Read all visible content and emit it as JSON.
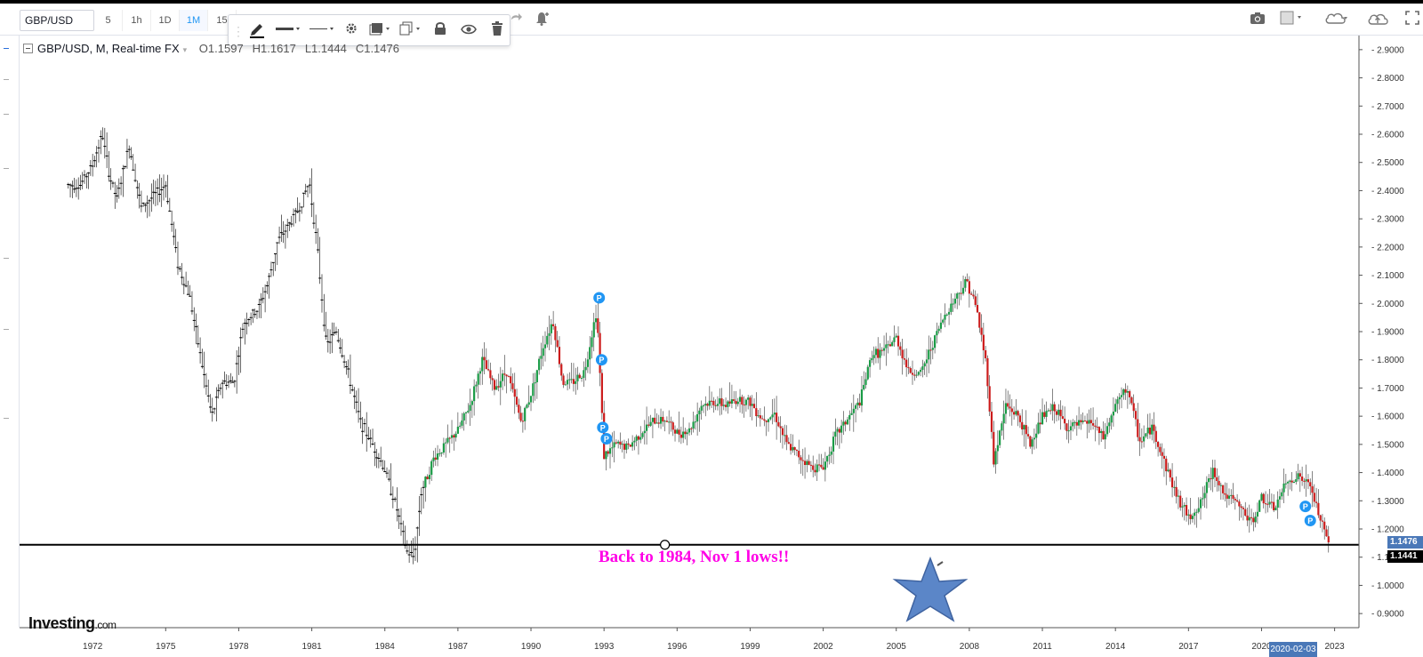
{
  "toolbar": {
    "symbol": "GBP/USD",
    "intervals": [
      "5",
      "1h",
      "1D",
      "1M",
      "15"
    ],
    "active_interval": "1M"
  },
  "legend": {
    "title": "GBP/USD, M, Real-time FX",
    "open": "O1.1597",
    "high": "H1.1617",
    "low": "L1.1444",
    "close": "C1.1476"
  },
  "annotation": {
    "text": "Back to 1984, Nov 1 lows!!",
    "color": "#ff00e6"
  },
  "logo": {
    "brand": "Investing",
    "suffix": ".com"
  },
  "price_axis": {
    "ticks": [
      "2.9000",
      "2.8000",
      "2.7000",
      "2.6000",
      "2.5000",
      "2.4000",
      "2.3000",
      "2.2000",
      "2.1000",
      "2.0000",
      "1.9000",
      "1.8000",
      "1.7000",
      "1.6000",
      "1.5000",
      "1.4000",
      "1.3000",
      "1.2000",
      "1.1000",
      "1.0000",
      "0.9000"
    ],
    "current_price": "1.1476",
    "line_price": "1.1441",
    "current_price_color": "#4a78b8",
    "line_price_color": "#000000"
  },
  "time_axis": {
    "ticks": [
      "1972",
      "1975",
      "1978",
      "1981",
      "1984",
      "1987",
      "1990",
      "1993",
      "1996",
      "1999",
      "2002",
      "2005",
      "2008",
      "2011",
      "2014",
      "2017",
      "2020",
      "2023"
    ],
    "cursor_date": "2020-02-03"
  },
  "colors": {
    "up_candle": "#1a9b46",
    "down_candle": "#cc1c1c",
    "legacy_bar": "#000000",
    "marker": "#2196f3"
  },
  "icons": [
    "camera-icon",
    "square-icon",
    "cloud-icon",
    "cloud-upload-icon",
    "fullscreen-icon",
    "pencil-icon",
    "line-icon",
    "settings-icon",
    "layers-icon",
    "clone-icon",
    "lock-icon",
    "eye-icon",
    "trash-icon",
    "alert-add-icon",
    "redo-icon"
  ],
  "chart_data": {
    "type": "line",
    "title": "GBP/USD, M, Real-time FX",
    "xlabel": "",
    "ylabel": "",
    "ylim": [
      0.85,
      2.95
    ],
    "x_range": [
      1969,
      2024
    ],
    "horizontal_line": 1.1441,
    "series": [
      {
        "values": [
          [
            1971.0,
            2.42
          ],
          [
            1971.5,
            2.42
          ],
          [
            1972.0,
            2.49
          ],
          [
            1972.4,
            2.6
          ],
          [
            1972.7,
            2.45
          ],
          [
            1973.0,
            2.37
          ],
          [
            1973.5,
            2.56
          ],
          [
            1974.0,
            2.34
          ],
          [
            1974.5,
            2.38
          ],
          [
            1975.0,
            2.42
          ],
          [
            1975.5,
            2.14
          ],
          [
            1976.0,
            2.02
          ],
          [
            1976.5,
            1.78
          ],
          [
            1976.9,
            1.6
          ],
          [
            1977.3,
            1.72
          ],
          [
            1977.8,
            1.72
          ],
          [
            1978.2,
            1.93
          ],
          [
            1978.8,
            1.98
          ],
          [
            1979.2,
            2.07
          ],
          [
            1979.6,
            2.22
          ],
          [
            1980.0,
            2.27
          ],
          [
            1980.5,
            2.34
          ],
          [
            1980.9,
            2.43
          ],
          [
            1981.2,
            2.22
          ],
          [
            1981.6,
            1.85
          ],
          [
            1982.0,
            1.9
          ],
          [
            1982.5,
            1.75
          ],
          [
            1983.0,
            1.58
          ],
          [
            1983.5,
            1.5
          ],
          [
            1984.0,
            1.41
          ],
          [
            1984.5,
            1.27
          ],
          [
            1984.9,
            1.12
          ],
          [
            1985.2,
            1.1
          ],
          [
            1985.5,
            1.33
          ],
          [
            1986.0,
            1.45
          ],
          [
            1986.5,
            1.5
          ],
          [
            1987.0,
            1.55
          ],
          [
            1987.5,
            1.64
          ],
          [
            1988.0,
            1.8
          ],
          [
            1988.5,
            1.7
          ],
          [
            1989.0,
            1.76
          ],
          [
            1989.6,
            1.58
          ],
          [
            1990.0,
            1.68
          ],
          [
            1990.5,
            1.85
          ],
          [
            1990.9,
            1.94
          ],
          [
            1991.3,
            1.72
          ],
          [
            1991.7,
            1.72
          ],
          [
            1992.2,
            1.76
          ],
          [
            1992.7,
            1.98
          ],
          [
            1993.0,
            1.46
          ],
          [
            1993.5,
            1.5
          ],
          [
            1994.0,
            1.49
          ],
          [
            1994.5,
            1.54
          ],
          [
            1995.0,
            1.58
          ],
          [
            1995.5,
            1.59
          ],
          [
            1996.0,
            1.54
          ],
          [
            1996.5,
            1.55
          ],
          [
            1997.0,
            1.64
          ],
          [
            1997.5,
            1.65
          ],
          [
            1998.0,
            1.64
          ],
          [
            1998.5,
            1.66
          ],
          [
            1999.0,
            1.65
          ],
          [
            1999.5,
            1.59
          ],
          [
            2000.0,
            1.61
          ],
          [
            2000.5,
            1.5
          ],
          [
            2001.0,
            1.46
          ],
          [
            2001.5,
            1.42
          ],
          [
            2002.0,
            1.42
          ],
          [
            2002.5,
            1.53
          ],
          [
            2003.0,
            1.59
          ],
          [
            2003.5,
            1.65
          ],
          [
            2004.0,
            1.82
          ],
          [
            2004.5,
            1.83
          ],
          [
            2005.0,
            1.88
          ],
          [
            2005.5,
            1.76
          ],
          [
            2006.0,
            1.75
          ],
          [
            2006.5,
            1.86
          ],
          [
            2007.0,
            1.96
          ],
          [
            2007.5,
            2.03
          ],
          [
            2007.9,
            2.08
          ],
          [
            2008.3,
            1.98
          ],
          [
            2008.7,
            1.78
          ],
          [
            2009.0,
            1.44
          ],
          [
            2009.5,
            1.64
          ],
          [
            2010.0,
            1.6
          ],
          [
            2010.5,
            1.5
          ],
          [
            2011.0,
            1.6
          ],
          [
            2011.5,
            1.63
          ],
          [
            2012.0,
            1.56
          ],
          [
            2012.5,
            1.57
          ],
          [
            2013.0,
            1.58
          ],
          [
            2013.5,
            1.52
          ],
          [
            2014.0,
            1.64
          ],
          [
            2014.5,
            1.7
          ],
          [
            2015.0,
            1.51
          ],
          [
            2015.5,
            1.56
          ],
          [
            2016.0,
            1.44
          ],
          [
            2016.5,
            1.32
          ],
          [
            2017.0,
            1.24
          ],
          [
            2017.5,
            1.29
          ],
          [
            2018.0,
            1.41
          ],
          [
            2018.5,
            1.32
          ],
          [
            2019.0,
            1.29
          ],
          [
            2019.6,
            1.22
          ],
          [
            2020.0,
            1.31
          ],
          [
            2020.5,
            1.27
          ],
          [
            2021.0,
            1.36
          ],
          [
            2021.5,
            1.39
          ],
          [
            2022.0,
            1.35
          ],
          [
            2022.5,
            1.21
          ],
          [
            2022.75,
            1.1476
          ]
        ]
      }
    ]
  }
}
